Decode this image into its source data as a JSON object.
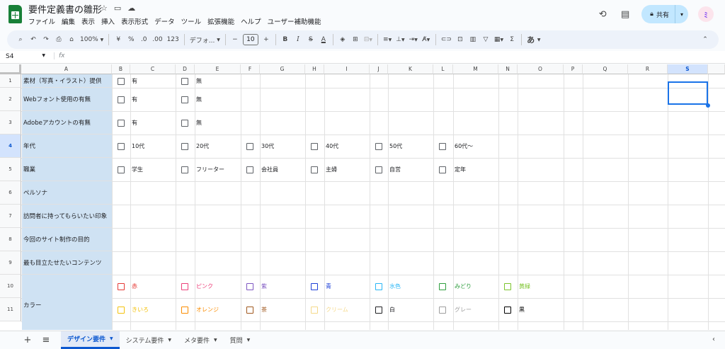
{
  "app": {
    "title": "要件定義書の雛形"
  },
  "menu": [
    "ファイル",
    "編集",
    "表示",
    "挿入",
    "表示形式",
    "データ",
    "ツール",
    "拡張機能",
    "ヘルプ",
    "ユーザー補助機能"
  ],
  "header": {
    "share_label": "共有",
    "avatar_letter": "ﾐ"
  },
  "toolbar": {
    "zoom": "100%",
    "currency": "¥",
    "percent": "%",
    "dec_decrease": ".0",
    "dec_increase": ".00",
    "number_format": "123",
    "font": "デフォ...",
    "font_size": "10",
    "input_tool": "あ"
  },
  "formula_bar": {
    "cell_ref": "S4",
    "fx": "fx",
    "value": ""
  },
  "columns": [
    "A",
    "B",
    "C",
    "D",
    "E",
    "F",
    "G",
    "H",
    "I",
    "J",
    "K",
    "L",
    "M",
    "N",
    "O",
    "P",
    "Q",
    "R",
    "S"
  ],
  "selected_column": "S",
  "rows": [
    "1",
    "2",
    "3",
    "4",
    "5",
    "6",
    "7",
    "8",
    "9",
    "10",
    "11"
  ],
  "selected_row": "4",
  "labels": [
    "素材（写真・イラスト）提供",
    "Webフォント使用の有無",
    "Adobeアカウントの有無",
    "年代",
    "職業",
    "ペルソナ",
    "訪問者に持ってもらいたい印象",
    "今回のサイト制作の目的",
    "最も目立たせたいコンテンツ",
    "カラー"
  ],
  "options": {
    "r1": [
      "有",
      "無"
    ],
    "r2": [
      "有",
      "無"
    ],
    "r3": [
      "有",
      "無"
    ],
    "r4": [
      "10代",
      "20代",
      "30代",
      "40代",
      "50代",
      "60代〜"
    ],
    "r5": [
      "学生",
      "フリーター",
      "会社員",
      "主婦",
      "自営",
      "定年"
    ]
  },
  "colors_row10": [
    {
      "label": "赤",
      "color": "#e53935"
    },
    {
      "label": "ピンク",
      "color": "#ec407a"
    },
    {
      "label": "紫",
      "color": "#7e57c2"
    },
    {
      "label": "青",
      "color": "#1e40d8"
    },
    {
      "label": "水色",
      "color": "#29b6f6"
    },
    {
      "label": "みどり",
      "color": "#2e9e3e"
    },
    {
      "label": "黄緑",
      "color": "#7cc42d"
    }
  ],
  "colors_row11": [
    {
      "label": "きいろ",
      "color": "#f4c20d"
    },
    {
      "label": "オレンジ",
      "color": "#fb8c00"
    },
    {
      "label": "茶",
      "color": "#a0581e"
    },
    {
      "label": "クリーム",
      "color": "#f5d98a"
    },
    {
      "label": "白",
      "color": "#202124"
    },
    {
      "label": "グレー",
      "color": "#9e9e9e"
    },
    {
      "label": "黒",
      "color": "#000000"
    }
  ],
  "sheets": [
    {
      "label": "デザイン要件",
      "active": true
    },
    {
      "label": "システム要件",
      "active": false
    },
    {
      "label": "メタ要件",
      "active": false
    },
    {
      "label": "質問",
      "active": false
    }
  ]
}
